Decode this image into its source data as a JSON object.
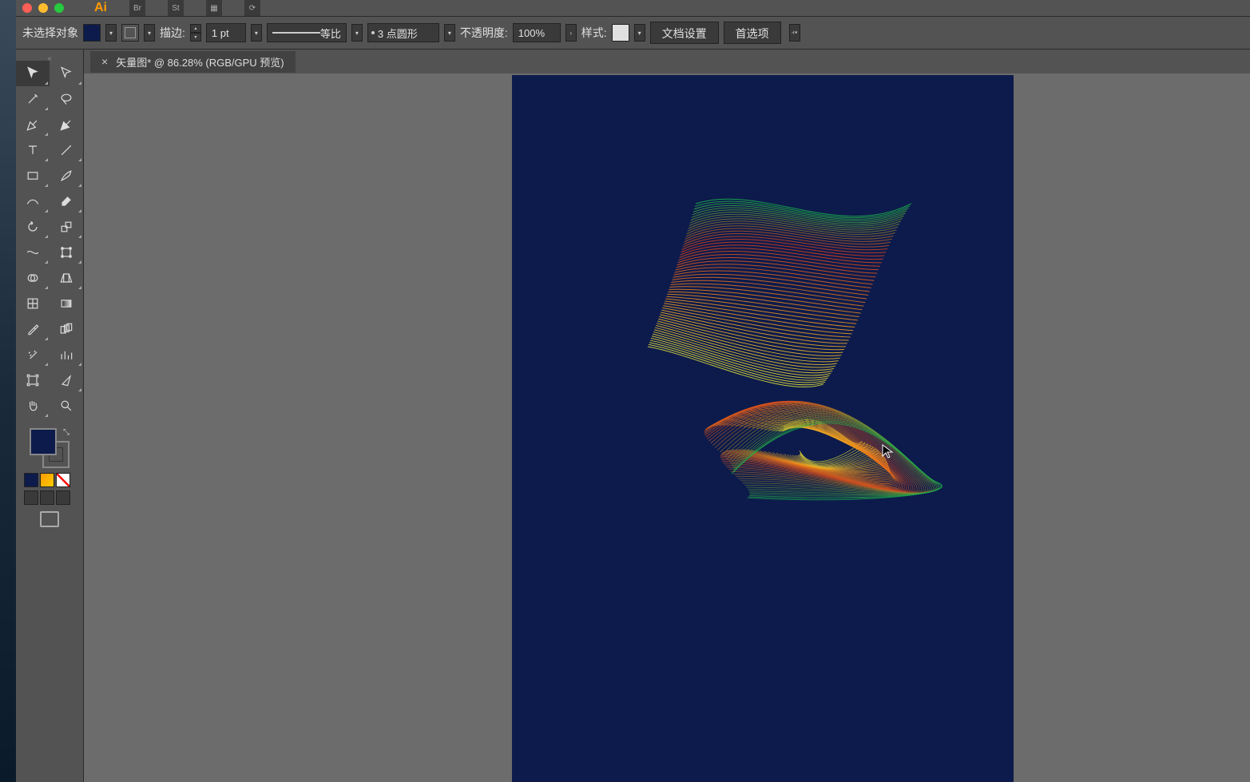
{
  "app": {
    "name": "Ai"
  },
  "controlbar": {
    "selection_status": "未选择对象",
    "stroke_label": "描边:",
    "stroke_weight": "1 pt",
    "profile_label": "等比",
    "brush_label": "3 点圆形",
    "opacity_label": "不透明度:",
    "opacity_value": "100%",
    "style_label": "样式:",
    "doc_setup_btn": "文档设置",
    "prefs_btn": "首选项"
  },
  "document": {
    "tab_title": "矢量图* @ 86.28% (RGB/GPU 预览)",
    "fill_color": "#0d1b4c",
    "artboard_bg": "#0d1b4c"
  },
  "tools": {
    "items": [
      "selection",
      "direct-select",
      "magic-wand",
      "lasso",
      "pen",
      "curvature",
      "type",
      "line",
      "rectangle",
      "paintbrush",
      "shaper",
      "eraser",
      "rotate",
      "scale",
      "width",
      "free-transform",
      "shape-builder",
      "perspective",
      "mesh",
      "gradient",
      "eyedropper",
      "blend",
      "symbol-sprayer",
      "column-graph",
      "artboard",
      "slice",
      "hand",
      "zoom"
    ]
  }
}
